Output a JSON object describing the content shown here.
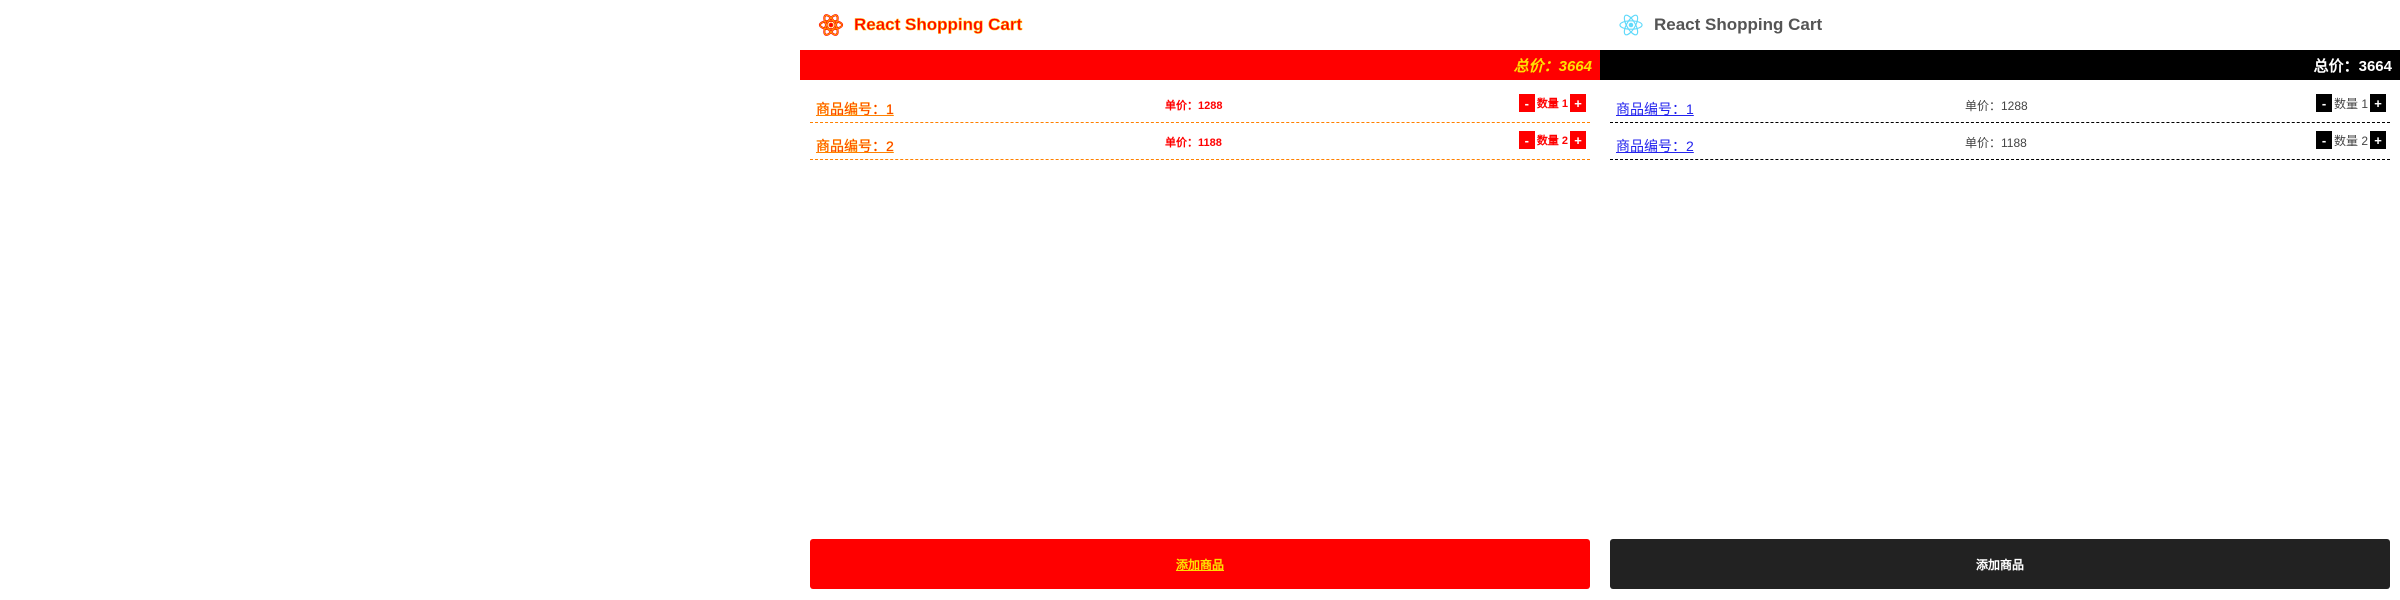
{
  "colors": {
    "debug_accent": "#ff0000",
    "debug_outline": "#ffb000",
    "normal_header_bar": "#000000",
    "normal_link": "#2222ee",
    "normal_button": "#222222",
    "react_logo": "#61dafb"
  },
  "debug_panel": {
    "header": {
      "logo_icon": "react-logo-icon",
      "title": "React Shopping Cart"
    },
    "total": "总价：3664",
    "items": [
      {
        "link": "商品编号：1",
        "price": "单价：1288",
        "minus": "-",
        "qty": "数量 1",
        "plus": "+"
      },
      {
        "link": "商品编号：2",
        "price": "单价：1188",
        "minus": "-",
        "qty": "数量 2",
        "plus": "+"
      }
    ],
    "add_button": "添加商品"
  },
  "normal_panel": {
    "header": {
      "logo_icon": "react-logo-icon",
      "title": "React Shopping Cart"
    },
    "total": "总价：3664",
    "items": [
      {
        "link": "商品编号：1",
        "price": "单价：1288",
        "minus": "-",
        "qty": "数量 1",
        "plus": "+"
      },
      {
        "link": "商品编号：2",
        "price": "单价：1188",
        "minus": "-",
        "qty": "数量 2",
        "plus": "+"
      }
    ],
    "add_button": "添加商品"
  }
}
